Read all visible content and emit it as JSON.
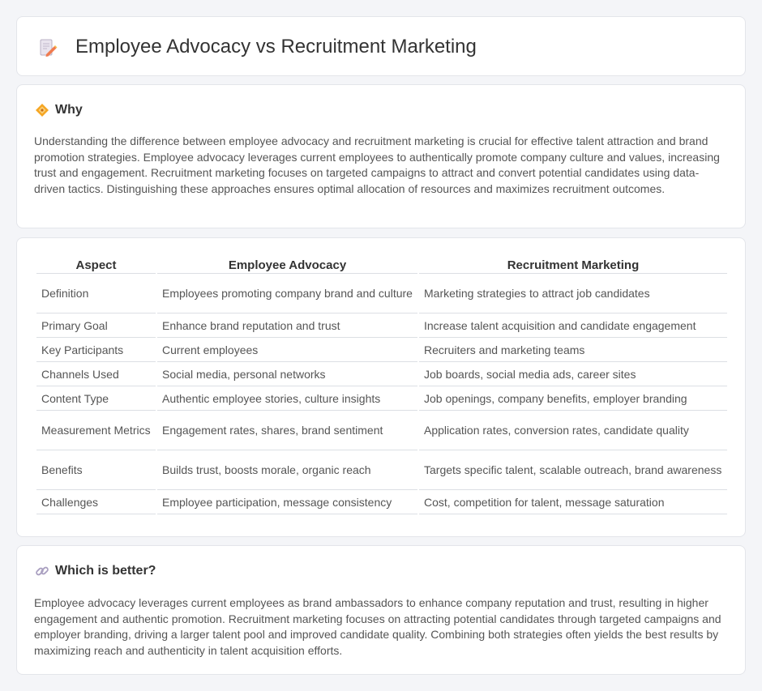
{
  "header": {
    "title": "Employee Advocacy vs Recruitment Marketing",
    "icon": "document-pencil-icon"
  },
  "why": {
    "heading": "Why",
    "icon": "diamond-icon",
    "text": "Understanding the difference between employee advocacy and recruitment marketing is crucial for effective talent attraction and brand promotion strategies. Employee advocacy leverages current employees to authentically promote company culture and values, increasing trust and engagement. Recruitment marketing focuses on targeted campaigns to attract and convert potential candidates using data-driven tactics. Distinguishing these approaches ensures optimal allocation of resources and maximizes recruitment outcomes."
  },
  "comparison": {
    "headers": [
      "Aspect",
      "Employee Advocacy",
      "Recruitment Marketing"
    ],
    "rows": [
      [
        "Definition",
        "Employees promoting company brand and culture",
        "Marketing strategies to attract job candidates"
      ],
      [
        "Primary Goal",
        "Enhance brand reputation and trust",
        "Increase talent acquisition and candidate engagement"
      ],
      [
        "Key Participants",
        "Current employees",
        "Recruiters and marketing teams"
      ],
      [
        "Channels Used",
        "Social media, personal networks",
        "Job boards, social media ads, career sites"
      ],
      [
        "Content Type",
        "Authentic employee stories, culture insights",
        "Job openings, company benefits, employer branding"
      ],
      [
        "Measurement Metrics",
        "Engagement rates, shares, brand sentiment",
        "Application rates, conversion rates, candidate quality"
      ],
      [
        "Benefits",
        "Builds trust, boosts morale, organic reach",
        "Targets specific talent, scalable outreach, brand awareness"
      ],
      [
        "Challenges",
        "Employee participation, message consistency",
        "Cost, competition for talent, message saturation"
      ]
    ]
  },
  "better": {
    "heading": "Which is better?",
    "icon": "link-icon",
    "text": "Employee advocacy leverages current employees as brand ambassadors to enhance company reputation and trust, resulting in higher engagement and authentic promotion. Recruitment marketing focuses on attracting potential candidates through targeted campaigns and employer branding, driving a larger talent pool and improved candidate quality. Combining both strategies often yields the best results by maximizing reach and authenticity in talent acquisition efforts."
  },
  "colors": {
    "accent_orange": "#f5a623",
    "background": "#f4f5f8",
    "card": "#ffffff"
  }
}
